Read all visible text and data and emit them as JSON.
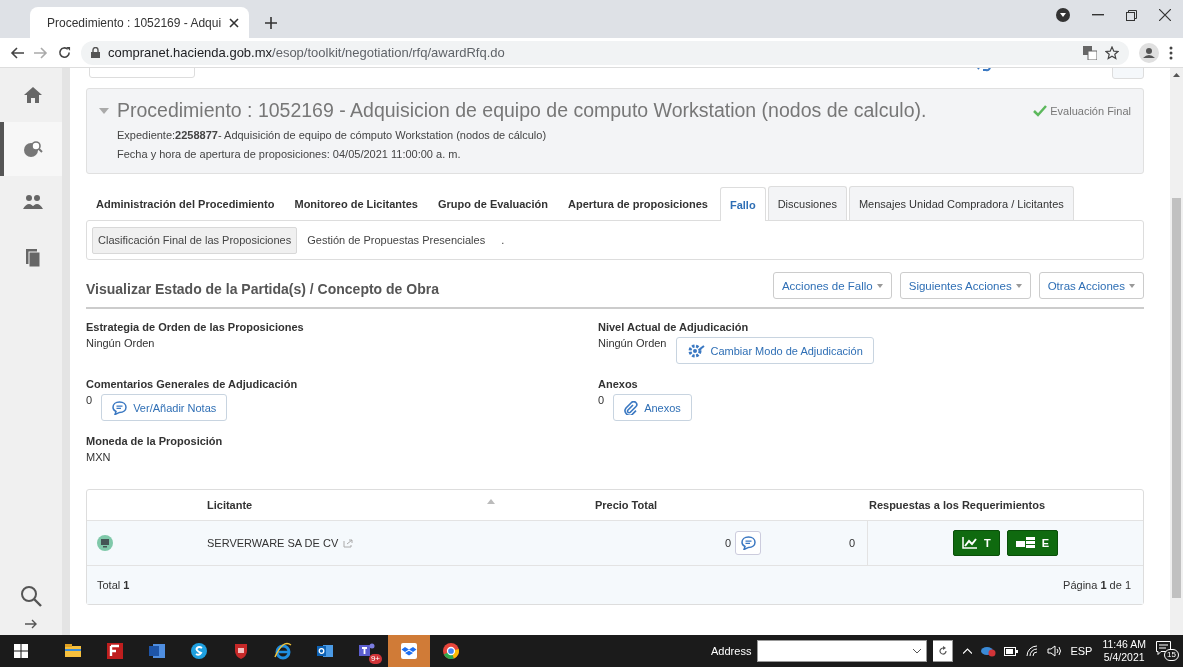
{
  "browser": {
    "tab_title": "Procedimiento : 1052169 - Adqui",
    "url_host": "compranet.hacienda.gob.mx",
    "url_path": "/esop/toolkit/negotiation/rfq/awardRfq.do"
  },
  "sidebar": {
    "items": [
      {
        "kind": "home",
        "selected": false
      },
      {
        "kind": "globe",
        "selected": true
      },
      {
        "kind": "people",
        "selected": false
      },
      {
        "kind": "docs",
        "selected": false
      }
    ]
  },
  "procedure": {
    "title": "Procedimiento : 1052169 - Adquisicion de equipo de computo Workstation (nodos de calculo).",
    "expediente": "Expediente:**2258877**- Adquisición de equipo de cómputo Workstation (nodos de cálculo)",
    "opening": "Fecha y hora de apertura de proposiciones: 04/05/2021 11:00:00 a. m.",
    "status": "Evaluación Final"
  },
  "tabs": [
    {
      "label": "Administración del Procedimiento",
      "kind": "plain",
      "selected": false
    },
    {
      "label": "Monitoreo de Licitantes",
      "kind": "plain",
      "selected": false
    },
    {
      "label": "Grupo de Evaluación",
      "kind": "plain",
      "selected": false
    },
    {
      "label": "Apertura de proposiciones",
      "kind": "plain",
      "selected": false
    },
    {
      "label": "Fallo",
      "kind": "boxed",
      "selected": true
    },
    {
      "label": "Discusiones",
      "kind": "boxed",
      "selected": false
    },
    {
      "label": "Mensajes Unidad Compradora / Licitantes",
      "kind": "boxed",
      "selected": false
    }
  ],
  "subtabs": [
    {
      "label": "Clasificación Final de las Proposiciones",
      "selected": true
    },
    {
      "label": "Gestión de Propuestas Presenciales",
      "selected": false
    },
    {
      "label": ".",
      "selected": false
    }
  ],
  "section": {
    "title": "Visualizar Estado de la Partida(s) / Concepto de Obra",
    "actions": [
      "Acciones de Fallo",
      "Siguientes Acciones",
      "Otras Acciones"
    ]
  },
  "fields": [
    {
      "label": "Estrategia de Orden de las Proposiciones",
      "value": "Ningún Orden"
    },
    {
      "label": "Nivel Actual de Adjudicación",
      "value": "Ningún Orden",
      "button": {
        "kind": "gear",
        "label": "Cambiar Modo de Adjudicación"
      }
    },
    {
      "label": "Comentarios Generales de Adjudicación",
      "value": "0",
      "button": {
        "kind": "comment",
        "label": "Ver/Añadir Notas"
      }
    },
    {
      "label": "Anexos",
      "value": "0",
      "button": {
        "kind": "paperclip",
        "label": "Anexos"
      }
    },
    {
      "label": "Moneda de la Proposición",
      "value": "MXN"
    }
  ],
  "table": {
    "columns": [
      "Licitante",
      "Precio Total",
      "Respuestas a los Requerimientos"
    ],
    "rows": [
      {
        "name": "SERVERWARE SA DE CV",
        "notes": "0",
        "price": "0",
        "responses": [
          {
            "kind": "technical",
            "label": "T"
          },
          {
            "kind": "economic",
            "label": "E"
          }
        ]
      }
    ],
    "total": "Total **1**",
    "page": "Página **1** de 1"
  },
  "taskbar": {
    "apps": [
      {
        "kind": "folder",
        "selected": false
      },
      {
        "kind": "filezilla",
        "selected": false
      },
      {
        "kind": "word",
        "selected": false
      },
      {
        "kind": "skype",
        "selected": false
      },
      {
        "kind": "shield",
        "selected": false
      },
      {
        "kind": "ie",
        "selected": false
      },
      {
        "kind": "outlook",
        "selected": false
      },
      {
        "kind": "teams",
        "selected": false,
        "badge": "9+"
      },
      {
        "kind": "dropbox",
        "selected": true
      },
      {
        "kind": "chrome",
        "selected": false
      }
    ],
    "address_label": "Address",
    "language": "ESP",
    "time": "11:46 AM",
    "date": "5/4/2021",
    "notifications": "15"
  }
}
